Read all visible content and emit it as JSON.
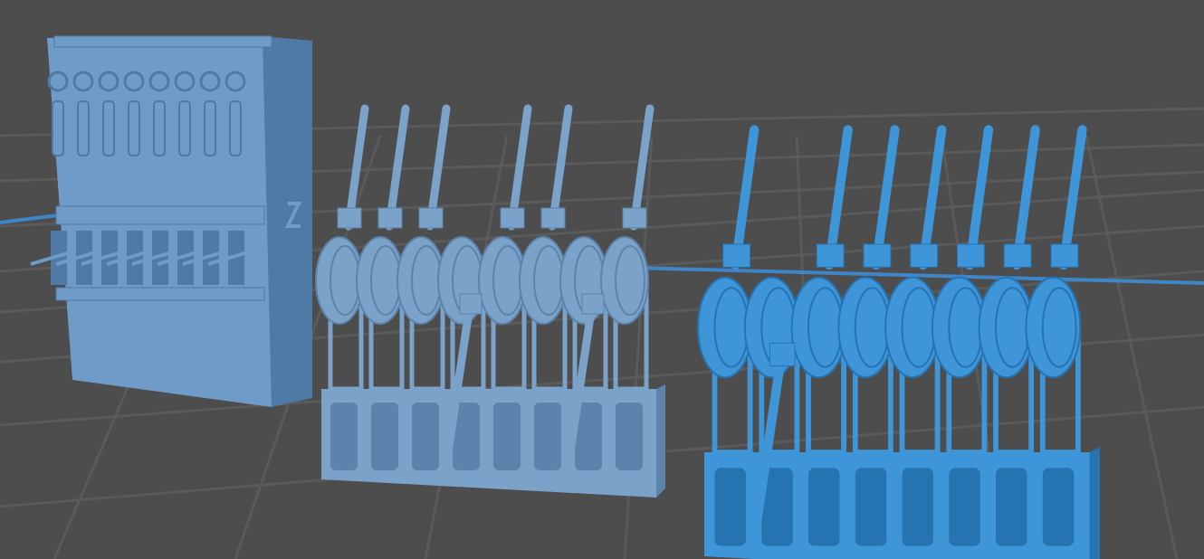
{
  "viewport": {
    "background": "#4d4d4d",
    "grid_color": "#5a5a5a",
    "axis_color": "#3f86c9"
  },
  "models": [
    {
      "name": "block",
      "style": "solid-housing",
      "color": "#6f9bc8",
      "shadow": "#4f7aa6",
      "slots": 8
    },
    {
      "name": "lever-assembly-grey",
      "style": "geared-wheels",
      "color": "#7ba2c9",
      "shadow": "#5b83ab",
      "levers": 8,
      "upright_levers": 6,
      "pulled_levers": 2
    },
    {
      "name": "lever-assembly-blue",
      "style": "smooth-wheels",
      "color": "#3e95d8",
      "shadow": "#2673b2",
      "levers": 8,
      "upright_levers": 7,
      "pulled_levers": 1
    }
  ]
}
